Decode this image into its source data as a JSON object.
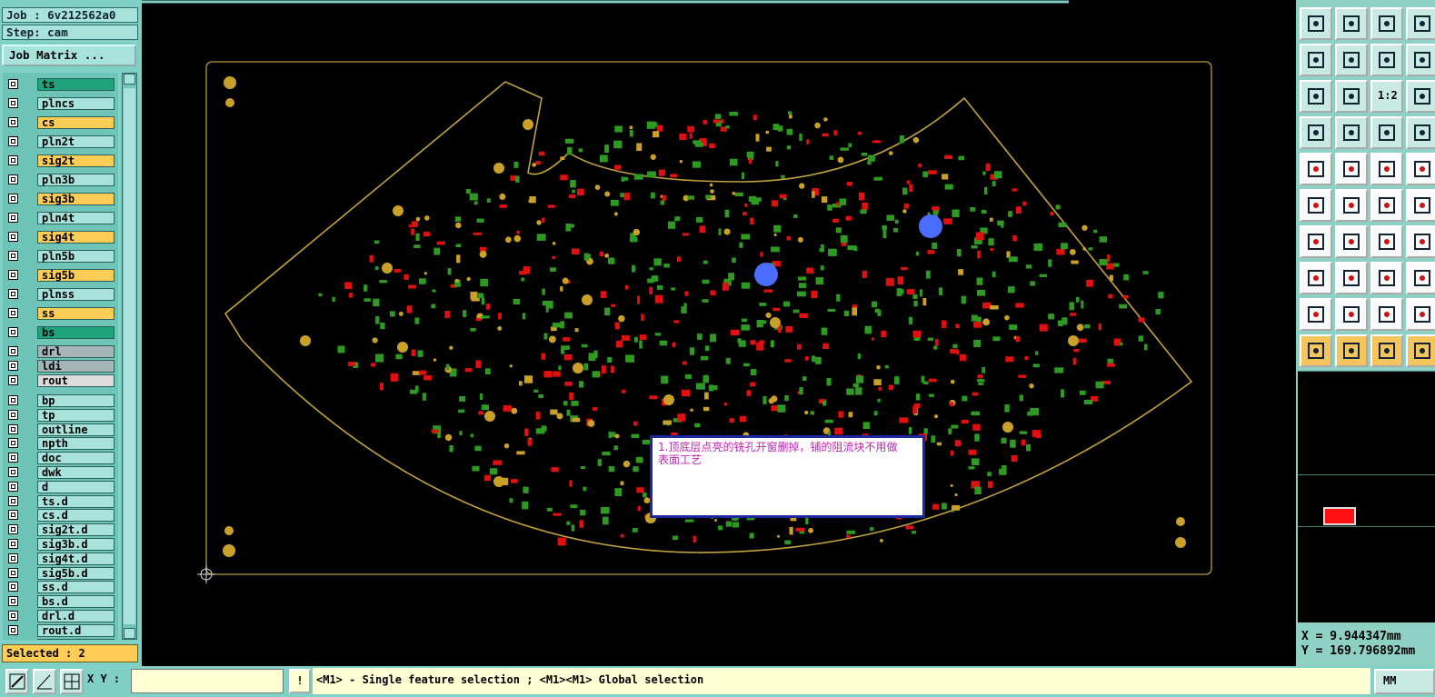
{
  "job": {
    "label": "Job : 6v212562a0",
    "step": "Step: cam",
    "matrix_button": "Job Matrix ..."
  },
  "layers": [
    {
      "name": "ts",
      "kind": "act"
    },
    {
      "name": "plncs",
      "kind": "board"
    },
    {
      "name": "cs",
      "kind": "sig"
    },
    {
      "name": "pln2t",
      "kind": "board"
    },
    {
      "name": "sig2t",
      "kind": "sig"
    },
    {
      "name": "pln3b",
      "kind": "board"
    },
    {
      "name": "sig3b",
      "kind": "sig"
    },
    {
      "name": "pln4t",
      "kind": "board"
    },
    {
      "name": "sig4t",
      "kind": "sig"
    },
    {
      "name": "pln5b",
      "kind": "board"
    },
    {
      "name": "sig5b",
      "kind": "sig"
    },
    {
      "name": "plnss",
      "kind": "board"
    },
    {
      "name": "ss",
      "kind": "sig"
    },
    {
      "name": "bs",
      "kind": "act"
    },
    {
      "name": "drl",
      "kind": "drl"
    },
    {
      "name": "ldi",
      "kind": "drl"
    },
    {
      "name": "rout",
      "kind": "rout"
    },
    {
      "name": "bp",
      "kind": "board"
    },
    {
      "name": "tp",
      "kind": "board"
    },
    {
      "name": "outline",
      "kind": "board"
    },
    {
      "name": "npth",
      "kind": "board"
    },
    {
      "name": "doc",
      "kind": "board"
    },
    {
      "name": "dwk",
      "kind": "board"
    },
    {
      "name": "d",
      "kind": "board"
    },
    {
      "name": "ts.d",
      "kind": "board"
    },
    {
      "name": "cs.d",
      "kind": "board"
    },
    {
      "name": "sig2t.d",
      "kind": "board"
    },
    {
      "name": "sig3b.d",
      "kind": "board"
    },
    {
      "name": "sig4t.d",
      "kind": "board"
    },
    {
      "name": "sig5b.d",
      "kind": "board"
    },
    {
      "name": "ss.d",
      "kind": "board"
    },
    {
      "name": "bs.d",
      "kind": "board"
    },
    {
      "name": "drl.d",
      "kind": "board"
    },
    {
      "name": "rout.d",
      "kind": "board"
    },
    {
      "name": "bs.d",
      "kind": "board"
    }
  ],
  "selected": "Selected : 2",
  "coords": {
    "x": "X = 9.944347mm",
    "y": "Y = 169.796892mm"
  },
  "bottom": {
    "xy_label": "X Y :",
    "xy_value": "",
    "warn": "!",
    "status": "<M1> - Single feature selection ; <M1><M1> Global selection",
    "units": "MM"
  },
  "note": {
    "line1": "1.顶底层点亮的铣孔开窗删掉，铺的阻流块不用做",
    "line2": "表面工艺"
  },
  "toolbox_icons": [
    "open-job-icon",
    "save-icon",
    "home-icon",
    "zoom-extents-icon",
    "step-back-icon",
    "step-forward-icon",
    "undo-icon",
    "panel-icon",
    "zoom-fit-icon",
    "zoom-center-icon",
    "zoom-ratio-icon",
    "pan-icon",
    "measure-icon",
    "grid-icon",
    "snap-icon",
    "snap-alt-icon",
    "add-pad-icon",
    "add-shape-icon",
    "ruler-icon",
    "select-box-icon",
    "connect-icon",
    "delete-icon",
    "move-icon",
    "drag-icon",
    "line-red-icon",
    "line-blue-icon",
    "arc-icon",
    "cut-icon",
    "pad-to-pad-icon",
    "dimension-icon",
    "center-icon",
    "align-icon",
    "angle-icon",
    "triangle-icon",
    "triangle-alt-icon",
    "arrow-triangle-icon",
    "pointer-icon",
    "pointer-red-icon",
    "pointer-circle-icon",
    "pointer-node-icon"
  ],
  "ratio_label": "1:2"
}
